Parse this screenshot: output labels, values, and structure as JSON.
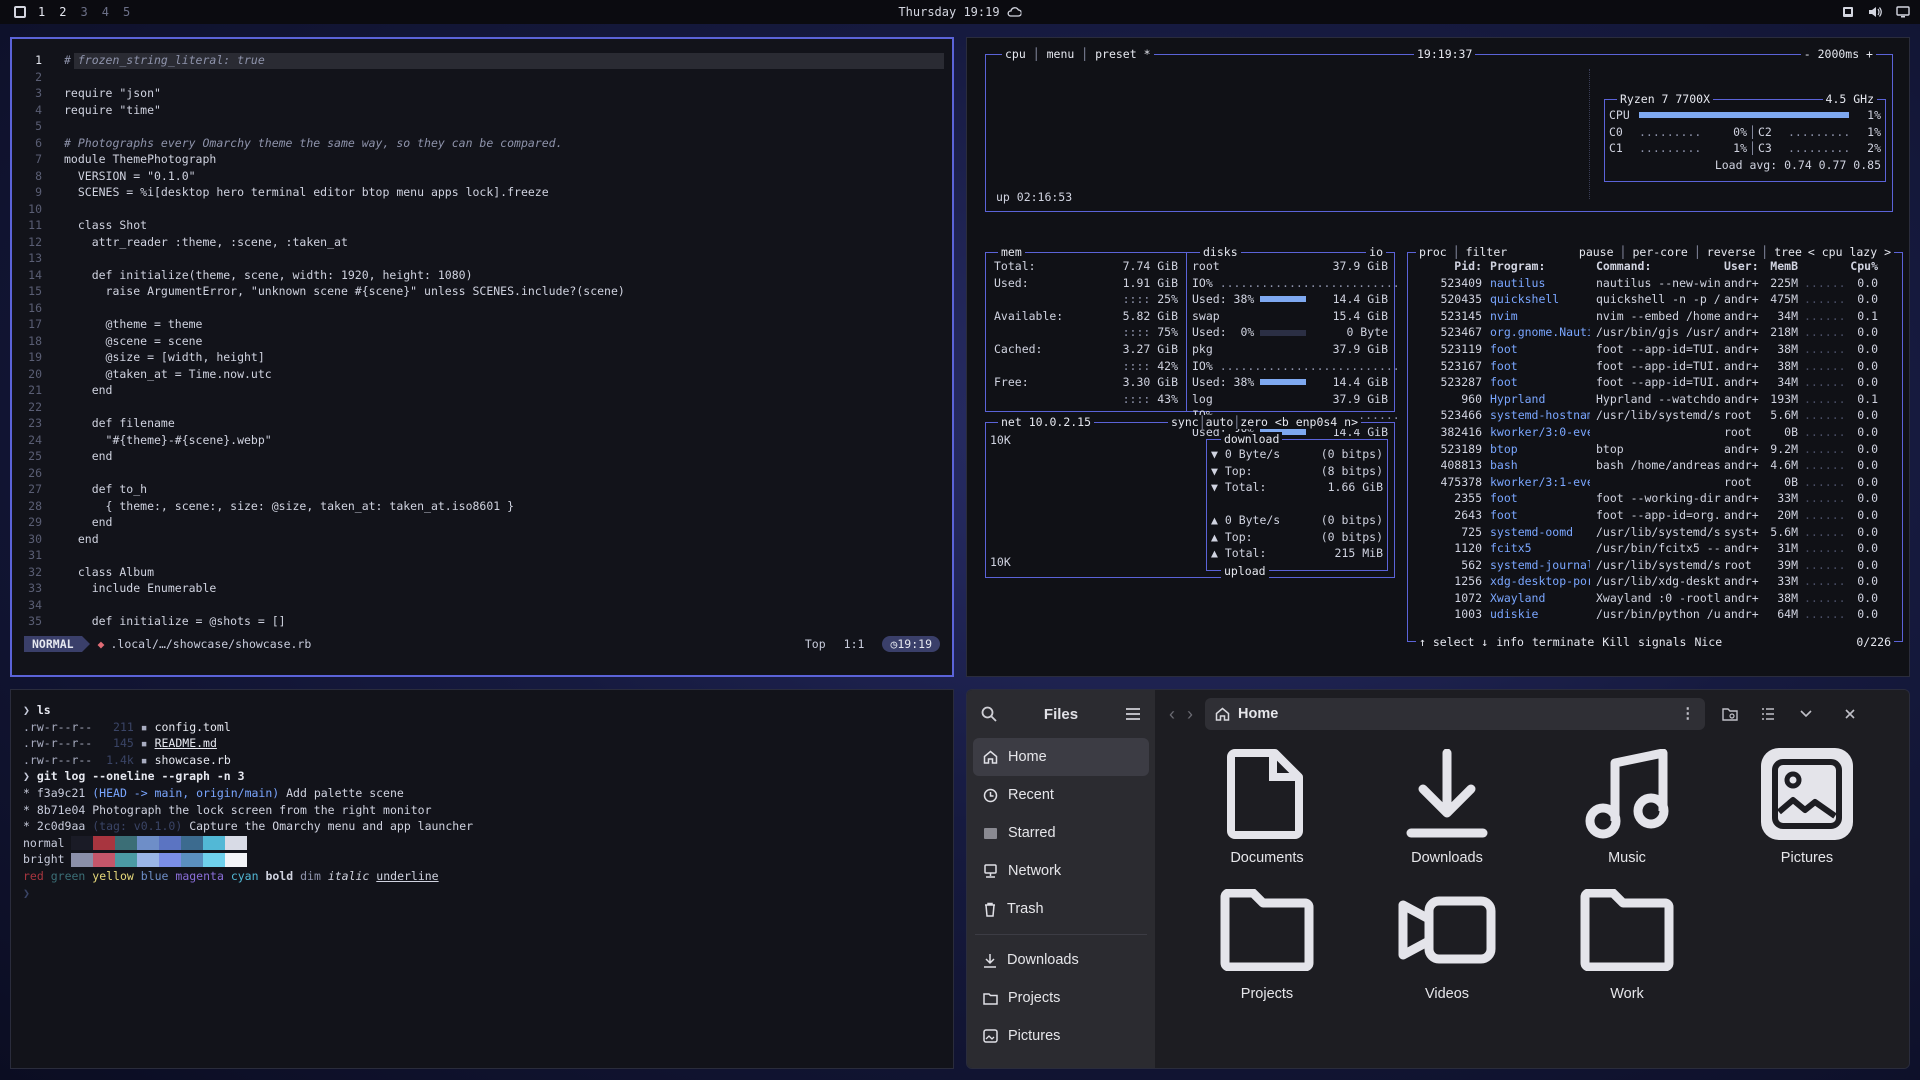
{
  "topbar": {
    "workspaces": [
      "1",
      "2",
      "3",
      "4",
      "5"
    ],
    "active_workspace": "1",
    "clock": "Thursday 19:19"
  },
  "editor": {
    "lines": [
      {
        "n": "1",
        "t": "# frozen_string_literal: true"
      },
      {
        "n": "2",
        "t": ""
      },
      {
        "n": "3",
        "t": "require \"json\""
      },
      {
        "n": "4",
        "t": "require \"time\""
      },
      {
        "n": "5",
        "t": ""
      },
      {
        "n": "6",
        "t": "# Photographs every Omarchy theme the same way, so they can be compared."
      },
      {
        "n": "7",
        "t": "module ThemePhotograph"
      },
      {
        "n": "8",
        "t": "  VERSION = \"0.1.0\""
      },
      {
        "n": "9",
        "t": "  SCENES = %i[desktop hero terminal editor btop menu apps lock].freeze"
      },
      {
        "n": "10",
        "t": ""
      },
      {
        "n": "11",
        "t": "  class Shot"
      },
      {
        "n": "12",
        "t": "    attr_reader :theme, :scene, :taken_at"
      },
      {
        "n": "13",
        "t": ""
      },
      {
        "n": "14",
        "t": "    def initialize(theme, scene, width: 1920, height: 1080)"
      },
      {
        "n": "15",
        "t": "      raise ArgumentError, \"unknown scene #{scene}\" unless SCENES.include?(scene)"
      },
      {
        "n": "16",
        "t": ""
      },
      {
        "n": "17",
        "t": "      @theme = theme"
      },
      {
        "n": "18",
        "t": "      @scene = scene"
      },
      {
        "n": "19",
        "t": "      @size = [width, height]"
      },
      {
        "n": "20",
        "t": "      @taken_at = Time.now.utc"
      },
      {
        "n": "21",
        "t": "    end"
      },
      {
        "n": "22",
        "t": ""
      },
      {
        "n": "23",
        "t": "    def filename"
      },
      {
        "n": "24",
        "t": "      \"#{theme}-#{scene}.webp\""
      },
      {
        "n": "25",
        "t": "    end"
      },
      {
        "n": "26",
        "t": ""
      },
      {
        "n": "27",
        "t": "    def to_h"
      },
      {
        "n": "28",
        "t": "      { theme:, scene:, size: @size, taken_at: taken_at.iso8601 }"
      },
      {
        "n": "29",
        "t": "    end"
      },
      {
        "n": "30",
        "t": "  end"
      },
      {
        "n": "31",
        "t": ""
      },
      {
        "n": "32",
        "t": "  class Album"
      },
      {
        "n": "33",
        "t": "    include Enumerable"
      },
      {
        "n": "34",
        "t": ""
      },
      {
        "n": "35",
        "t": "    def initialize = @shots = []"
      }
    ],
    "status": {
      "mode": "NORMAL",
      "path": ".local/…/showcase/showcase.rb",
      "position": "Top",
      "cursor": "1:1",
      "time": "19:19"
    }
  },
  "btop": {
    "cpu_box": {
      "labels": [
        "cpu",
        "menu",
        "preset *"
      ],
      "clock": "19:19:37",
      "interval": "- 2000ms +",
      "uptime": "up 02:16:53",
      "model": "Ryzen 7 7700X",
      "freq": "4.5 GHz",
      "cpu_total": {
        "label": "CPU",
        "value": "1%"
      },
      "cores": [
        {
          "l": "C0",
          "v": "0%"
        },
        {
          "l": "C2",
          "v": "1%"
        },
        {
          "l": "C1",
          "v": "1%"
        },
        {
          "l": "C3",
          "v": "2%"
        }
      ],
      "load_avg": "Load avg: 0.74 0.77 0.85"
    },
    "mem": {
      "title": "mem",
      "rows": [
        {
          "k": "Total:",
          "v": "7.74 GiB"
        },
        {
          "k": "Used:",
          "v": "1.91 GiB",
          "p": "25%"
        },
        {
          "k": "Available:",
          "v": "5.82 GiB",
          "p": "75%"
        },
        {
          "k": "Cached:",
          "v": "3.27 GiB",
          "p": "42%"
        },
        {
          "k": "Free:",
          "v": "3.30 GiB",
          "p": "43%"
        }
      ]
    },
    "disks": {
      "title": "disks",
      "io": "io",
      "entries": [
        {
          "name": "root",
          "size": "37.9 GiB",
          "io": "IO%",
          "used": "Used: 38%",
          "usedv": "14.4 GiB"
        },
        {
          "name": "swap",
          "size": "15.4 GiB",
          "io": "",
          "used": "Used:  0%",
          "usedv": "0 Byte"
        },
        {
          "name": "pkg",
          "size": "37.9 GiB",
          "io": "IO%",
          "used": "Used: 38%",
          "usedv": "14.4 GiB"
        },
        {
          "name": "log",
          "size": "37.9 GiB",
          "io": "IO%",
          "used": "Used: 38%",
          "usedv": "14.4 GiB"
        }
      ]
    },
    "net": {
      "title": "net",
      "ip": "10.0.2.15",
      "opts": [
        "sync",
        "auto",
        "zero"
      ],
      "iface": "<b enp0s4 n>",
      "scale_top": "10K",
      "scale_bottom": "10K",
      "download_label": "download",
      "upload_label": "upload",
      "download": [
        {
          "k": "▼ 0 Byte/s",
          "v": "(0 bitps)"
        },
        {
          "k": "▼ Top:",
          "v": "(8 bitps)"
        },
        {
          "k": "▼ Total:",
          "v": "1.66 GiB"
        }
      ],
      "upload": [
        {
          "k": "▲ 0 Byte/s",
          "v": "(0 bitps)"
        },
        {
          "k": "▲ Top:",
          "v": "(0 bitps)"
        },
        {
          "k": "▲ Total:",
          "v": "215 MiB"
        }
      ]
    },
    "proc": {
      "header_opts": [
        "proc",
        "filter",
        "pause",
        "per-core",
        "reverse",
        "tree",
        "< cpu lazy >"
      ],
      "columns": [
        "Pid:",
        "Program:",
        "Command:",
        "User:",
        "MemB",
        "",
        "Cpu%"
      ],
      "rows": [
        [
          "523409",
          "nautilus",
          "nautilus --new-win",
          "andr+",
          "225M",
          "0.0"
        ],
        [
          "520435",
          "quickshell",
          "quickshell -n -p /",
          "andr+",
          "475M",
          "0.0"
        ],
        [
          "523145",
          "nvim",
          "nvim --embed /home",
          "andr+",
          "34M",
          "0.1"
        ],
        [
          "523467",
          "org.gnome.Nauti",
          "/usr/bin/gjs /usr/",
          "andr+",
          "218M",
          "0.0"
        ],
        [
          "523119",
          "foot",
          "foot --app-id=TUI.",
          "andr+",
          "38M",
          "0.0"
        ],
        [
          "523167",
          "foot",
          "foot --app-id=TUI.",
          "andr+",
          "38M",
          "0.0"
        ],
        [
          "523287",
          "foot",
          "foot --app-id=TUI.",
          "andr+",
          "34M",
          "0.0"
        ],
        [
          "960",
          "Hyprland",
          "Hyprland --watchdo",
          "andr+",
          "193M",
          "0.1"
        ],
        [
          "523466",
          "systemd-hostnam",
          "/usr/lib/systemd/s",
          "root",
          "5.6M",
          "0.0"
        ],
        [
          "382416",
          "kworker/3:0-even",
          "",
          "root",
          "0B",
          "0.0"
        ],
        [
          "523189",
          "btop",
          "btop",
          "andr+",
          "9.2M",
          "0.0"
        ],
        [
          "408813",
          "bash",
          "bash /home/andreas",
          "andr+",
          "4.6M",
          "0.0"
        ],
        [
          "475378",
          "kworker/3:1-even",
          "",
          "root",
          "0B",
          "0.0"
        ],
        [
          "2355",
          "foot",
          "foot --working-dir",
          "andr+",
          "33M",
          "0.0"
        ],
        [
          "2643",
          "foot",
          "foot --app-id=org.",
          "andr+",
          "20M",
          "0.0"
        ],
        [
          "725",
          "systemd-oomd",
          "/usr/lib/systemd/s",
          "syst+",
          "5.6M",
          "0.0"
        ],
        [
          "1120",
          "fcitx5",
          "/usr/bin/fcitx5 --",
          "andr+",
          "31M",
          "0.0"
        ],
        [
          "562",
          "systemd-journal",
          "/usr/lib/systemd/s",
          "root",
          "39M",
          "0.0"
        ],
        [
          "1256",
          "xdg-desktop-por",
          "/usr/lib/xdg-deskt",
          "andr+",
          "33M",
          "0.0"
        ],
        [
          "1072",
          "Xwayland",
          "Xwayland :0 -rootl",
          "andr+",
          "38M",
          "0.0"
        ],
        [
          "1003",
          "udiskie",
          "/usr/bin/python /u",
          "andr+",
          "64M",
          "0.0"
        ]
      ],
      "footer": [
        "↑ select ↓",
        "info",
        "terminate",
        "Kill",
        "signals",
        "Nice"
      ],
      "count": "0/226"
    }
  },
  "terminal": {
    "lines": [
      {
        "prompt": "❯",
        "text": "ls"
      },
      {
        "perm": ".rw-r--r--",
        "size": "211",
        "name": "config.toml"
      },
      {
        "perm": ".rw-r--r--",
        "size": "145",
        "name": "README.md"
      },
      {
        "perm": ".rw-r--r--",
        "size": "1.4k",
        "name": "showcase.rb"
      },
      {
        "prompt": "❯",
        "text": "git log --oneline --graph -n 3"
      },
      {
        "hash": "* f3a9c21",
        "ref": "(HEAD -> main, origin/main)",
        "msg": "Add palette scene"
      },
      {
        "hash": "* 8b71e04",
        "ref": "",
        "msg": "Photograph the lock screen from the right monitor"
      },
      {
        "hash": "* 2c0d9aa",
        "ref": "(tag: v0.1.0)",
        "msg": "Capture the Omarchy menu and app launcher"
      }
    ],
    "palette_normal_label": "normal",
    "palette_bright_label": "bright",
    "palette_normal": [
      "#1a1b26",
      "#a8353f",
      "#3b6e76",
      "#6e8ec8",
      "#5b74c2",
      "#3c6b8f",
      "#52b8d6",
      "#d8dbe6"
    ],
    "palette_bright": [
      "#8a8fa8",
      "#c4566a",
      "#4b9aa4",
      "#9bb6e8",
      "#7b8ee8",
      "#5a8fbf",
      "#6fd0ec",
      "#f2f3f7"
    ],
    "styles": [
      "red",
      "green",
      "yellow",
      "blue",
      "magenta",
      "cyan",
      "bold",
      "dim",
      "italic",
      "underline"
    ],
    "prompt_end": "❯"
  },
  "files": {
    "sidebar_title": "Files",
    "sidebar": [
      {
        "label": "Home",
        "icon": "home-icon",
        "active": true
      },
      {
        "label": "Recent",
        "icon": "clock-icon"
      },
      {
        "label": "Starred",
        "icon": "star-icon"
      },
      {
        "label": "Network",
        "icon": "network-icon"
      },
      {
        "label": "Trash",
        "icon": "trash-icon"
      }
    ],
    "bookmarks": [
      {
        "label": "Downloads",
        "icon": "download-icon"
      },
      {
        "label": "Projects",
        "icon": "folder-icon"
      },
      {
        "label": "Pictures",
        "icon": "image-icon"
      }
    ],
    "path": "Home",
    "items": [
      {
        "label": "Documents",
        "icon": "document-icon"
      },
      {
        "label": "Downloads",
        "icon": "download-icon"
      },
      {
        "label": "Music",
        "icon": "music-icon"
      },
      {
        "label": "Pictures",
        "icon": "pictures-icon"
      },
      {
        "label": "Projects",
        "icon": "folder-icon"
      },
      {
        "label": "Videos",
        "icon": "video-icon"
      },
      {
        "label": "Work",
        "icon": "folder-icon"
      }
    ]
  }
}
